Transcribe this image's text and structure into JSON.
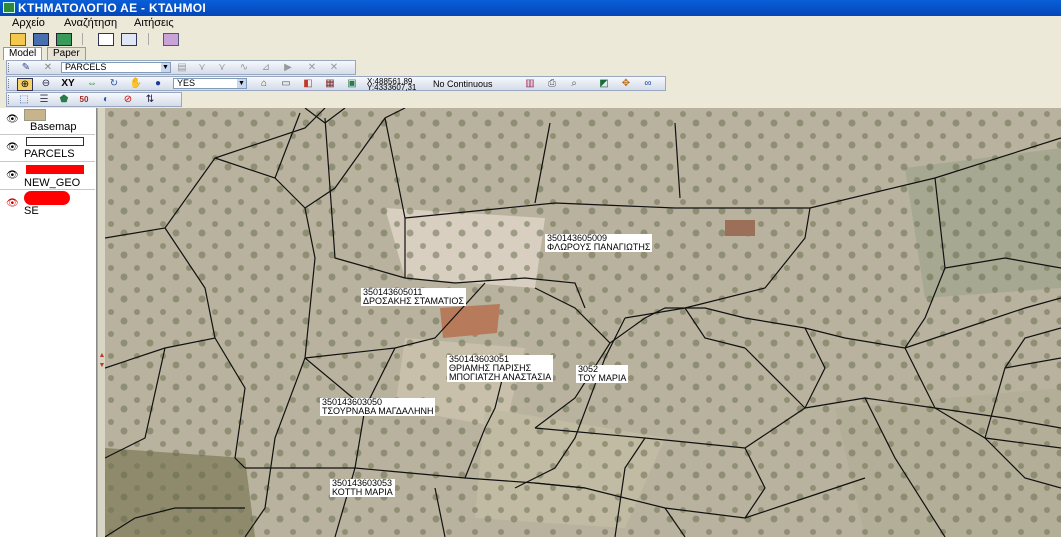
{
  "window": {
    "title": "ΚΤΗΜΑΤΟΛΟΓΙΟ ΑΕ - ΚΤΔΗΜΟΙ"
  },
  "menu": [
    "Αρχείο",
    "Αναζήτηση",
    "Αιτήσεις"
  ],
  "tabs": [
    {
      "label": "Model",
      "active": true
    },
    {
      "label": "Paper",
      "active": false
    }
  ],
  "toolbar1": {
    "layer_select": "PARCELS"
  },
  "toolbar2": {
    "yes_select": "YES",
    "coord_x": "X:488561,89",
    "coord_y": "Y:4333607,31",
    "snap_mode": "No Continuous"
  },
  "layers": [
    {
      "name": "Basemap"
    },
    {
      "name": "PARCELS",
      "color": "#ffffff"
    },
    {
      "name": "NEW_GEO",
      "color": "#ff0000"
    },
    {
      "name": "SE",
      "color": "#ff0000"
    }
  ],
  "parcels": [
    {
      "code": "350143605009",
      "owner": "ΦΛΩΡΟΥΣ ΠΑΝΑΓΙΩΤΗΣ"
    },
    {
      "code": "350143605011",
      "owner": "ΔΡΟΣΑΚΗΣ ΣΤΑΜΑΤΙΟΣ"
    },
    {
      "code": "350143603051",
      "owner": "ΘΡΙΑΜΗΣ ΠΑΡΙΣΗΣ",
      "owner2": "ΜΠΟΓΙΑΤΖΗ ΑΝΑΣΤΑΣΙΑ"
    },
    {
      "code": "3052",
      "owner": "ΤΟΥ ΜΑΡΙΑ"
    },
    {
      "code": "350143603050",
      "owner": "ΤΣΟΥΡΝΑΒΑ ΜΑΓΔΑΛΗΝΗ"
    },
    {
      "code": "350143603053",
      "owner": "ΚΟΤΤΗ ΜΑΡΙΑ"
    }
  ]
}
